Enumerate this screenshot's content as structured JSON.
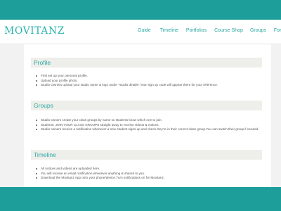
{
  "brand": {
    "logo_text": "MOVITANZ"
  },
  "nav": {
    "items": [
      {
        "label": "Guide"
      },
      {
        "label": "Timeline"
      },
      {
        "label": "Portfolios"
      },
      {
        "label": "Course Shop"
      },
      {
        "label": "Groups"
      },
      {
        "label": "Forum"
      }
    ]
  },
  "sections": [
    {
      "title": "Profile",
      "bullets": [
        "First set up your personal profile.",
        "Upload your profile photo.",
        "Studio Owners upload your studio name & logo under \"studio details\".Your sign up code will appear there for your reference."
      ]
    },
    {
      "title": "Groups",
      "bullets": [
        "Studio owners create your class groups by name so students know which one to join.",
        "Students: JOIN YOUR CLASS GROUPS straight away to receive videos & notices.",
        "Studio owners receive a notification whenever a new student signs up and check they're in their correct class group.You can switch their group if needed."
      ]
    },
    {
      "title": "Timeline",
      "bullets": [
        "All notices and videos are uploaded here.",
        "You will receive an email notification whenever anything is shared to you.",
        "Download the Movitanz App onto your phone/device.Turn notifications on for Movitanz."
      ]
    }
  ],
  "colors": {
    "teal": "#1d9e9a",
    "accent": "#2aa9a4",
    "header_bg": "#eeeeea"
  }
}
